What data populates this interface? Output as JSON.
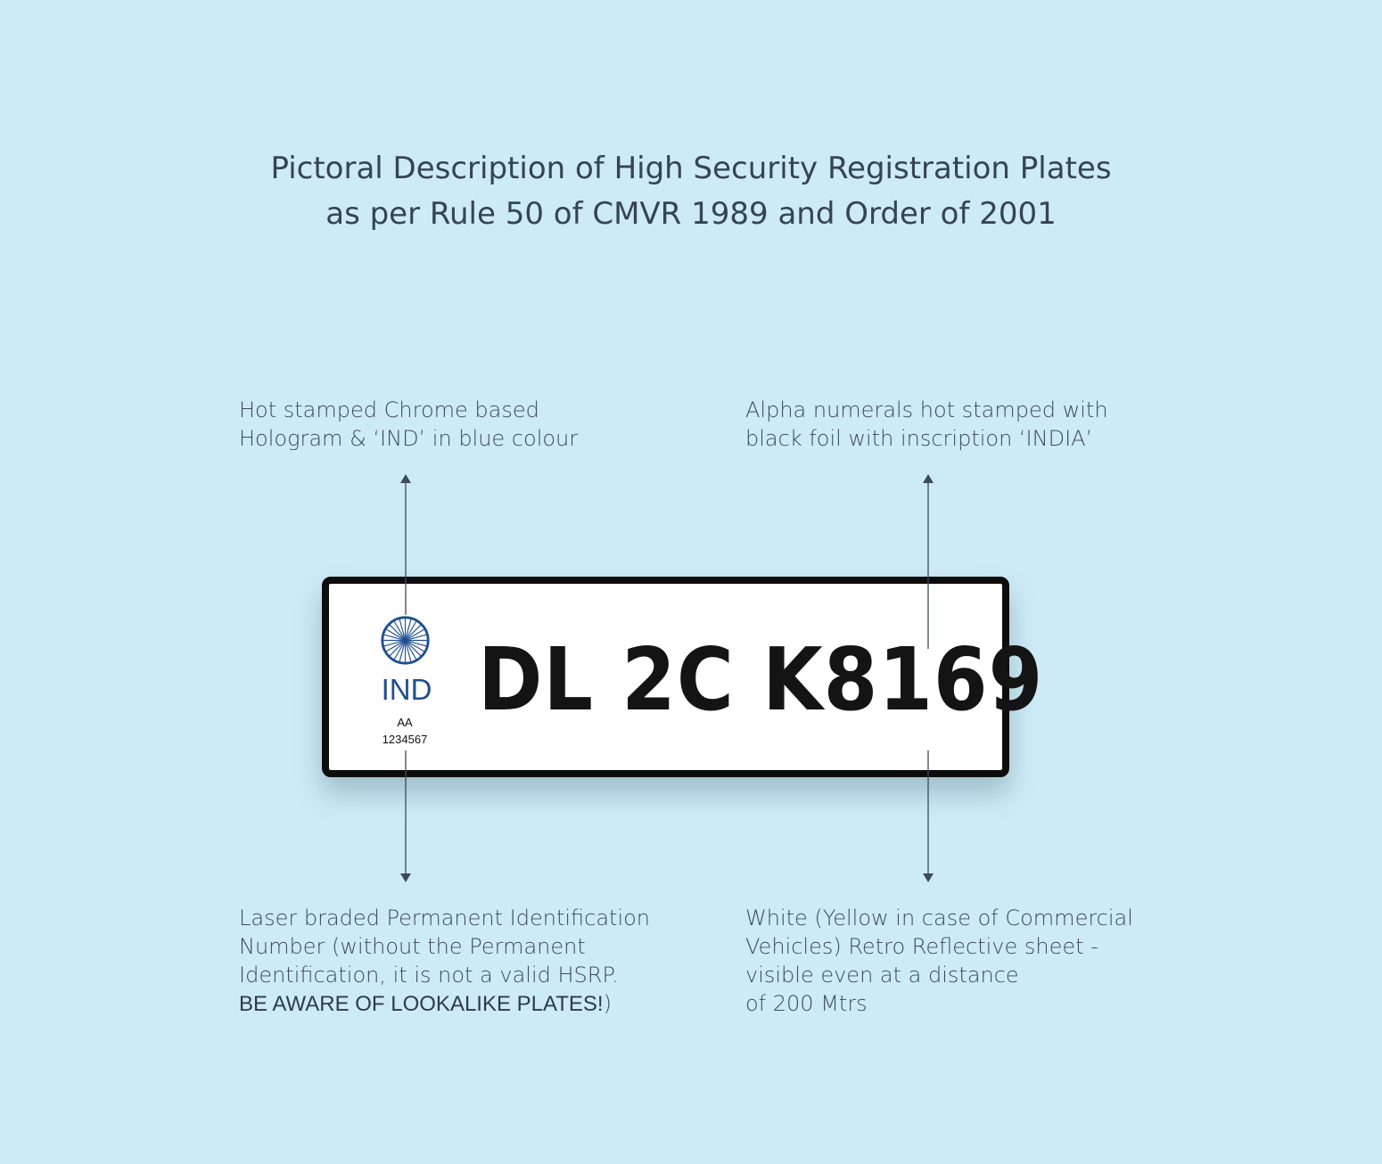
{
  "title": {
    "line1": "Pictoral Description of High Security Registration Plates",
    "line2": "as per Rule 50 of CMVR 1989 and Order of 2001"
  },
  "notes": {
    "top_left": {
      "line1": "Hot stamped Chrome based",
      "line2": "Hologram & ‘IND’ in blue colour"
    },
    "top_right": {
      "line1": "Alpha numerals hot stamped with",
      "line2": "black foil with inscription ‘INDIA’"
    },
    "bottom_left": {
      "line1": "Laser braded Permanent Identification",
      "line2": "Number (without the Permanent",
      "line3": "Identification, it is not a valid HSRP.",
      "line4_emphasis": "BE AWARE OF LOOKALIKE PLATES!",
      "line4_suffix": ")"
    },
    "bottom_right": {
      "line1": "White (Yellow in case of Commercial",
      "line2": "Vehicles) Retro Reflective sheet -",
      "line3": "visible even at a distance",
      "line4": "of 200 Mtrs"
    }
  },
  "plate": {
    "country_code": "IND",
    "pin_series": "AA",
    "pin_number": "1234567",
    "registration_number": "DL 2C K8169",
    "emblem_icon": "ashoka-chakra-icon"
  },
  "colors": {
    "background": "#cdebf6",
    "text": "#3e4a5c",
    "ind_blue": "#1f4f8f",
    "plate_border": "#0d0d0d",
    "arrow": "#3e4a5c"
  }
}
